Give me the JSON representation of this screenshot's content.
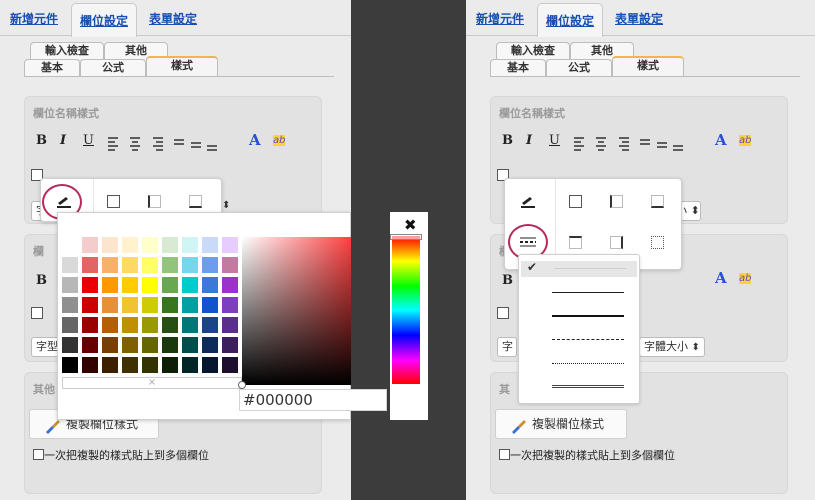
{
  "tabs": {
    "add": "新增元件",
    "field": "欄位設定",
    "form": "表單設定"
  },
  "subtabs": {
    "input_check": "輸入檢查",
    "other": "其他",
    "basic": "基本",
    "formula": "公式",
    "style": "樣式"
  },
  "style_group": {
    "title": "欄位名稱樣式",
    "bold": "B",
    "italic": "I",
    "underline": "U",
    "font_color_letter": "A",
    "highlight_letters": "ab"
  },
  "font_select": {
    "short": "字",
    "short2": "字型",
    "mid": "字",
    "size_label": "字體大小"
  },
  "other_group": {
    "title": "其他",
    "title_short": "其",
    "copy_button": "複製欄位樣式",
    "copy_checkbox_label": "一次把複製的樣式貼上到多個欄位"
  },
  "color_picker": {
    "hex_value": "#000000",
    "clear_symbol": "×",
    "close_symbol": "✖"
  },
  "border_styles": {
    "selected_mark": "✔",
    "options": [
      "none",
      "solid-thin",
      "solid-thick",
      "dashed",
      "dotted",
      "double"
    ]
  },
  "colors": {
    "accent_orange": "#f2b54a",
    "link_blue": "#1a4fb0",
    "highlight_circle": "#b5295c",
    "font_a_blue": "#2a4fd6"
  },
  "palette": [
    [
      "#ffffff",
      "#f4cccc",
      "#fce5cd",
      "#fff2cc",
      "#ffffcc",
      "#d9ead3",
      "#d0f5f5",
      "#c9daf8",
      "#e6ccff"
    ],
    [
      "#d9d9d9",
      "#e06666",
      "#f6b26b",
      "#ffd966",
      "#ffff66",
      "#93c47d",
      "#76d7ea",
      "#6d9eeb",
      "#c27ba0"
    ],
    [
      "#b7b7b7",
      "#ea0000",
      "#ff9900",
      "#ffcc00",
      "#ffff00",
      "#6aa84f",
      "#00cccc",
      "#3c78d8",
      "#9933cc"
    ],
    [
      "#8f8f8f",
      "#cc0000",
      "#e69138",
      "#f1c232",
      "#cccc00",
      "#38761d",
      "#00a0a0",
      "#1155cc",
      "#7e3fbf"
    ],
    [
      "#666666",
      "#990000",
      "#b45f06",
      "#bf9000",
      "#999900",
      "#274e13",
      "#007777",
      "#1c4587",
      "#5b2e8a"
    ],
    [
      "#333333",
      "#660000",
      "#783f04",
      "#7f6000",
      "#666600",
      "#1a3a0d",
      "#004d4d",
      "#0c2a5a",
      "#3d1e5c"
    ],
    [
      "#000000",
      "#330000",
      "#3d1f00",
      "#403000",
      "#333300",
      "#0d1f06",
      "#002626",
      "#061530",
      "#1e0f2e"
    ]
  ],
  "field_icons": [
    "pen-underline",
    "box-all",
    "box-left",
    "box-bottom",
    "dashed-line-style",
    "box-top",
    "box-right",
    "box-dotted"
  ]
}
